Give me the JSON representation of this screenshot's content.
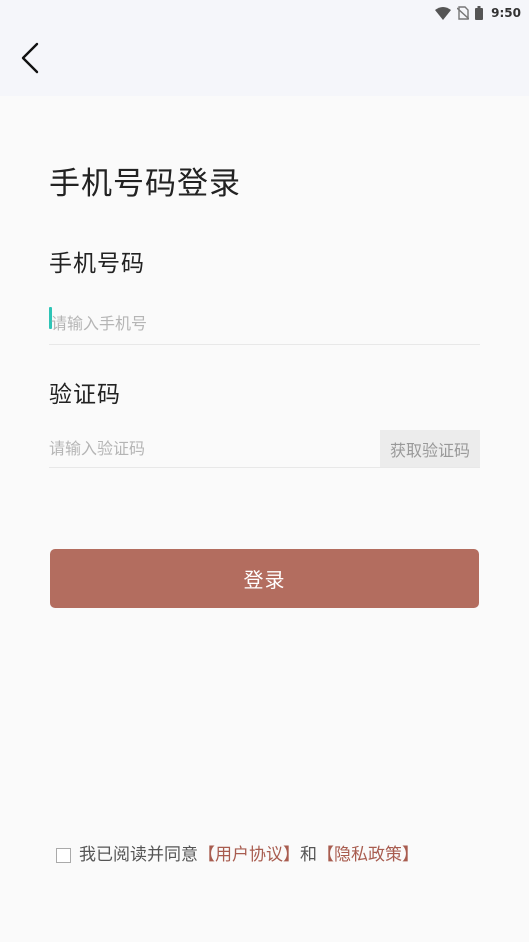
{
  "status_bar": {
    "time": "9:50",
    "icons": [
      "wifi-icon",
      "no-sim-icon",
      "battery-icon"
    ]
  },
  "app_bar": {
    "back_icon": "chevron-left-icon"
  },
  "login": {
    "title": "手机号码登录",
    "phone_label": "手机号码",
    "phone_placeholder": "请输入手机号",
    "phone_value": "",
    "code_label": "验证码",
    "code_placeholder": "请输入验证码",
    "code_value": "",
    "get_code_label": "获取验证码",
    "submit_label": "登录"
  },
  "agreement": {
    "prefix": "我已阅读并同意",
    "user_agreement": "【用户协议】",
    "conjunction": "和",
    "privacy_policy": "【隐私政策】",
    "checked": false
  },
  "colors": {
    "primary": "#b36d5f",
    "link": "#a85c4f",
    "caret": "#2ec4b6",
    "background": "#fafafa",
    "header_background": "#f5f6fa"
  }
}
